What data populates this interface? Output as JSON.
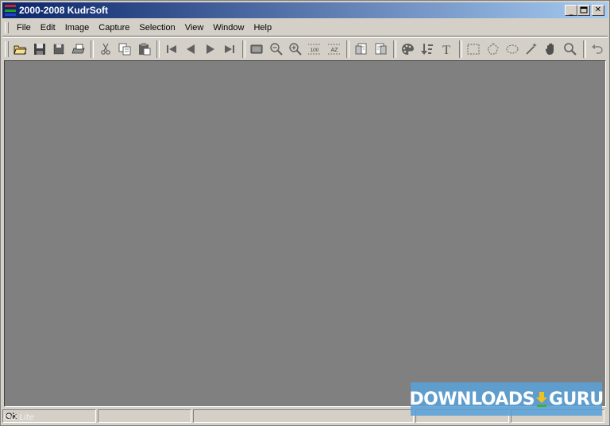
{
  "window": {
    "title": "2000-2008 KudrSoft",
    "buttons": {
      "minimize_icon": "minimize-icon",
      "maximize_icon": "maximize-icon",
      "close_icon": "close-icon"
    }
  },
  "menubar": {
    "items": [
      "File",
      "Edit",
      "Image",
      "Capture",
      "Selection",
      "View",
      "Window",
      "Help"
    ]
  },
  "toolbar": {
    "groups": [
      [
        "open-icon",
        "save-icon",
        "save-all-icon",
        "print-icon"
      ],
      [
        "cut-icon",
        "copy-icon",
        "paste-icon"
      ],
      [
        "first-icon",
        "previous-icon",
        "next-icon",
        "last-icon"
      ],
      [
        "fit-window-icon",
        "zoom-out-icon",
        "zoom-in-icon",
        "actual-size-icon",
        "auto-zoom-icon"
      ],
      [
        "rotate-left-icon",
        "rotate-right-icon"
      ],
      [
        "palette-icon",
        "sort-icon",
        "text-icon"
      ],
      [
        "rect-select-icon",
        "lasso-select-icon",
        "ellipse-select-icon",
        "magic-wand-icon",
        "hand-icon",
        "magnifier-icon"
      ],
      [
        "undo-icon"
      ]
    ],
    "labels": {
      "actual_size": "100",
      "auto_zoom": "AZ",
      "text_tool": "T"
    }
  },
  "statusbar": {
    "panels": [
      "Ok",
      "",
      "",
      "",
      ""
    ],
    "caption": "ISO Lite"
  },
  "watermark": {
    "text_left": "DOWNLOADS",
    "text_right": "GURU"
  },
  "colors": {
    "workspace": "#808080",
    "chrome": "#d4d0c8",
    "title_start": "#0a246a",
    "title_end": "#a6caf0",
    "watermark": "#5aa0d7"
  }
}
